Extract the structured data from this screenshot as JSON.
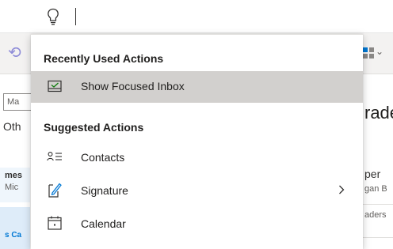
{
  "background": {
    "left_input_text": "Ma",
    "left_heading": "Oth",
    "left_sender": "mes",
    "left_preview": "Mic",
    "left_bottom_text": "s Ca",
    "right_heading": "rade",
    "right_line1": "per",
    "right_line2": "gan B",
    "right_line3": "aders"
  },
  "dropdown": {
    "sections": [
      {
        "title": "Recently Used Actions",
        "items": [
          {
            "label": "Show Focused Inbox",
            "icon": "focused-inbox-icon",
            "selected": true
          }
        ]
      },
      {
        "title": "Suggested Actions",
        "items": [
          {
            "label": "Contacts",
            "icon": "contacts-icon"
          },
          {
            "label": "Signature",
            "icon": "signature-icon",
            "has_submenu": true
          },
          {
            "label": "Calendar",
            "icon": "calendar-icon"
          }
        ]
      }
    ]
  },
  "colors": {
    "selected_row": "#d2d0ce",
    "accent": "#0078d4",
    "undo": "#8e8cd8"
  }
}
